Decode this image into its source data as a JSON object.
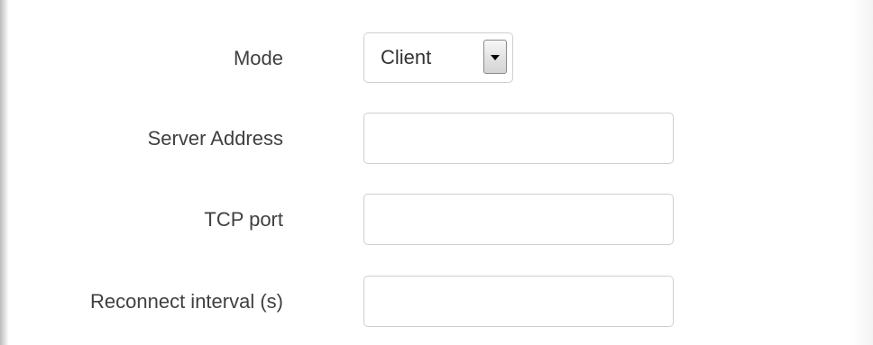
{
  "form": {
    "mode": {
      "label": "Mode",
      "selected": "Client"
    },
    "server_address": {
      "label": "Server Address",
      "value": "",
      "placeholder": ""
    },
    "tcp_port": {
      "label": "TCP port",
      "value": "",
      "placeholder": ""
    },
    "reconnect_interval": {
      "label": "Reconnect interval (s)",
      "value": "",
      "placeholder": ""
    }
  },
  "icons": {
    "dropdown": "chevron-down-icon"
  },
  "colors": {
    "label_text": "#404040",
    "input_border": "#cfcfcf",
    "background": "#ffffff"
  }
}
